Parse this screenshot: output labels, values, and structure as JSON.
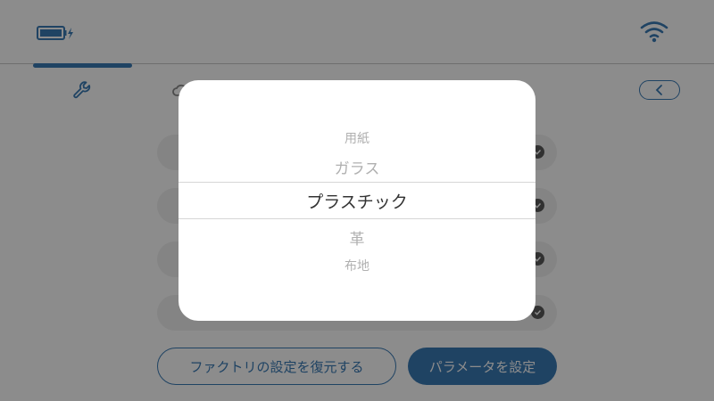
{
  "status": {
    "battery_icon": "battery-charging-icon",
    "wifi_icon": "wifi-icon"
  },
  "tabs": [
    {
      "icon": "wrench-icon",
      "active": true
    },
    {
      "icon": "cloud-icon",
      "active": false
    }
  ],
  "back_icon": "chevron-left-icon",
  "buttons": {
    "restore_label": "ファクトリの設定を復元する",
    "set_label": "パラメータを設定"
  },
  "picker": {
    "options": [
      "用紙",
      "ガラス",
      "プラスチック",
      "革",
      "布地"
    ],
    "selected": "プラスチック"
  },
  "colors": {
    "accent": "#3a7ab5",
    "overlay": "rgba(0,0,0,0.45)"
  }
}
